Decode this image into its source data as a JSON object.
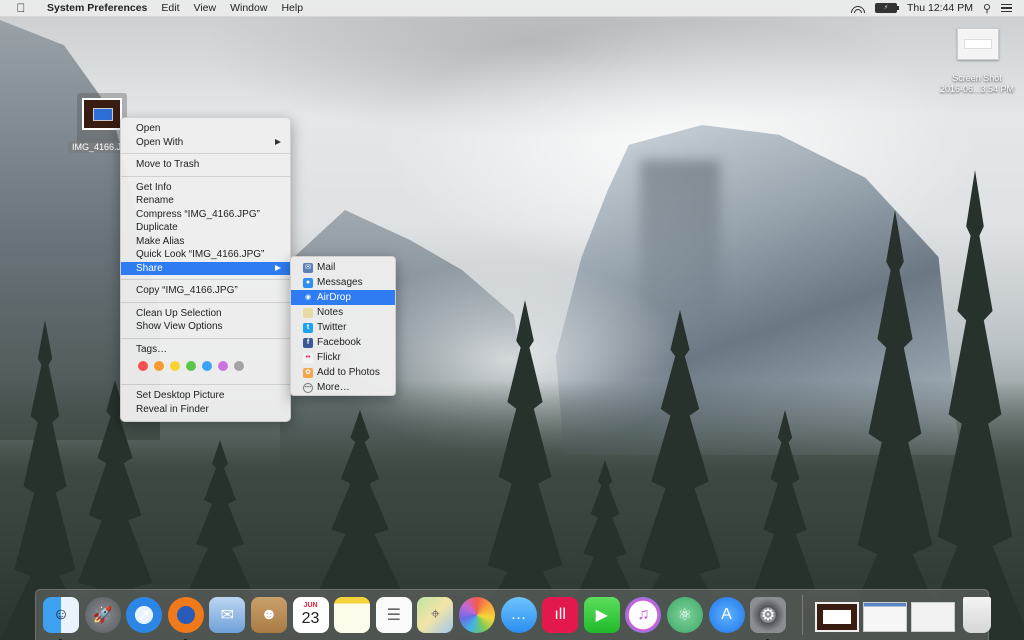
{
  "menubar": {
    "apple_icon": "apple-logo-icon",
    "app_name": "System Preferences",
    "menus": [
      "Edit",
      "View",
      "Window",
      "Help"
    ],
    "status": {
      "wifi_icon": "wifi-icon",
      "battery_icon": "battery-charging-icon",
      "battery_text": "⚡",
      "clock": "Thu 12:44 PM",
      "spotlight_icon": "spotlight-search-icon",
      "notification_icon": "notification-center-icon"
    }
  },
  "desktop": {
    "icons": [
      {
        "label": "IMG_4166.J...",
        "type": "image-file",
        "selected": true
      },
      {
        "label_line1": "Screen Shot",
        "label_line2": "2016-06...3.54 PM",
        "type": "screenshot-file"
      }
    ]
  },
  "context_menu": {
    "groups": [
      [
        {
          "label": "Open"
        },
        {
          "label": "Open With",
          "submenu": true
        }
      ],
      [
        {
          "label": "Move to Trash"
        }
      ],
      [
        {
          "label": "Get Info"
        },
        {
          "label": "Rename"
        },
        {
          "label": "Compress “IMG_4166.JPG”"
        },
        {
          "label": "Duplicate"
        },
        {
          "label": "Make Alias"
        },
        {
          "label": "Quick Look “IMG_4166.JPG”"
        },
        {
          "label": "Share",
          "submenu": true,
          "highlighted": true
        }
      ],
      [
        {
          "label": "Copy “IMG_4166.JPG”"
        }
      ],
      [
        {
          "label": "Clean Up Selection"
        },
        {
          "label": "Show View Options"
        }
      ],
      [
        {
          "label": "Tags…"
        }
      ],
      [
        {
          "label": "Set Desktop Picture"
        },
        {
          "label": "Reveal in Finder"
        }
      ]
    ],
    "tag_colors": [
      {
        "name": "red",
        "color": "#f8504f"
      },
      {
        "name": "orange",
        "color": "#f99a2e"
      },
      {
        "name": "yellow",
        "color": "#f6d332"
      },
      {
        "name": "green",
        "color": "#5ac74a"
      },
      {
        "name": "blue",
        "color": "#3ba3f7"
      },
      {
        "name": "purple",
        "color": "#cc73e1"
      },
      {
        "name": "gray",
        "color": "#a3a3a6"
      }
    ]
  },
  "share_menu": {
    "items": [
      {
        "label": "Mail",
        "icon": "mail-icon",
        "color": "#5b7fb6",
        "glyph": "✉"
      },
      {
        "label": "Messages",
        "icon": "messages-icon",
        "color": "#2f8ef0",
        "glyph": "●"
      },
      {
        "label": "AirDrop",
        "icon": "airdrop-icon",
        "color": "#2f7cf2",
        "glyph": "◉",
        "highlighted": true
      },
      {
        "label": "Notes",
        "icon": "notes-icon",
        "color": "#e9d9a2",
        "glyph": ""
      },
      {
        "label": "Twitter",
        "icon": "twitter-icon",
        "color": "#1da1f2",
        "glyph": "t"
      },
      {
        "label": "Facebook",
        "icon": "facebook-icon",
        "color": "#3b5998",
        "glyph": "f"
      },
      {
        "label": "Flickr",
        "icon": "flickr-icon",
        "color": "#f4f4f4",
        "glyph": "••"
      },
      {
        "label": "Add to Photos",
        "icon": "photos-icon",
        "color": "#f2a54a",
        "glyph": "✿"
      },
      {
        "label": "More…",
        "icon": "more-icon",
        "color": "#dddddd",
        "glyph": "⋯"
      }
    ]
  },
  "dock": {
    "apps": [
      {
        "name": "Finder",
        "icon": "finder-icon",
        "bg": "linear-gradient(90deg,#3da0f0 50%,#e8f3fb 50%)",
        "glyph": "☺",
        "running": true,
        "round": false
      },
      {
        "name": "Launchpad",
        "icon": "launchpad-icon",
        "bg": "radial-gradient(circle,#8a8d91,#55585c)",
        "glyph": "🚀",
        "running": false,
        "round": true
      },
      {
        "name": "Safari",
        "icon": "safari-icon",
        "bg": "radial-gradient(circle,#e9f3ff 35%,#2b86e6 36%)",
        "glyph": "➚",
        "running": false,
        "round": true
      },
      {
        "name": "Firefox",
        "icon": "firefox-icon",
        "bg": "radial-gradient(circle,#2a5bb8 35%,#f07a1a 36%)",
        "glyph": "",
        "running": true,
        "round": true
      },
      {
        "name": "Mail",
        "icon": "mail-stamp-icon",
        "bg": "linear-gradient(#bcd6f2,#6fa0d8)",
        "glyph": "✉",
        "running": false,
        "round": false
      },
      {
        "name": "Contacts",
        "icon": "contacts-icon",
        "bg": "linear-gradient(#c9a06a,#a97b44)",
        "glyph": "☻",
        "running": false,
        "round": false
      },
      {
        "name": "Calendar",
        "icon": "calendar-icon",
        "bg": "#ffffff",
        "glyph": "23",
        "month": "JUN",
        "running": false,
        "round": false
      },
      {
        "name": "Notes",
        "icon": "notes-app-icon",
        "bg": "linear-gradient(#f6d23a 18%,#fdfbe9 18%)",
        "glyph": "",
        "running": false,
        "round": false
      },
      {
        "name": "Reminders",
        "icon": "reminders-icon",
        "bg": "#fafafa",
        "glyph": "☰",
        "running": false,
        "round": false
      },
      {
        "name": "Maps",
        "icon": "maps-icon",
        "bg": "linear-gradient(135deg,#bfe3a6,#f3e4a6,#9cc8ef)",
        "glyph": "⌖",
        "running": false,
        "round": false
      },
      {
        "name": "Photos",
        "icon": "photos-app-icon",
        "bg": "conic-gradient(#f25b4c,#f6a33a,#f6d83a,#77c95a,#3fb4e8,#6b6ce3,#c467d8,#f25b4c)",
        "glyph": "",
        "running": false,
        "round": true
      },
      {
        "name": "Messages",
        "icon": "messages-app-icon",
        "bg": "linear-gradient(#6fc4ff,#2a8ef0)",
        "glyph": "…",
        "running": false,
        "round": true
      },
      {
        "name": "Scrivener",
        "icon": "red-app-icon",
        "bg": "#e3194d",
        "glyph": "ıll",
        "running": false,
        "round": false
      },
      {
        "name": "FaceTime",
        "icon": "facetime-icon",
        "bg": "linear-gradient(#5bde5b,#21b92a)",
        "glyph": "▶",
        "running": false,
        "round": false
      },
      {
        "name": "iTunes",
        "icon": "itunes-icon",
        "bg": "radial-gradient(circle,#fff 55%,#d95ad4 57%,#5b8ef2 80%)",
        "glyph": "♫",
        "running": false,
        "round": true
      },
      {
        "name": "Atom",
        "icon": "atom-icon",
        "bg": "radial-gradient(circle,#7fd39a,#3ba767)",
        "glyph": "⚛",
        "running": false,
        "round": true
      },
      {
        "name": "App Store",
        "icon": "app-store-icon",
        "bg": "radial-gradient(circle,#5cb3ff,#1f73e8)",
        "glyph": "A",
        "running": false,
        "round": true
      },
      {
        "name": "System Preferences",
        "icon": "system-preferences-icon",
        "bg": "radial-gradient(circle,#8e9196 30%,#4e5156 31%,#8a8d92 65%)",
        "glyph": "⚙",
        "running": true,
        "round": false
      }
    ],
    "minimized_windows": [
      {
        "name": "IMG_4166 preview window",
        "icon": "image-window-thumbnail"
      },
      {
        "name": "Firefox window",
        "icon": "firefox-window-thumbnail"
      },
      {
        "name": "System Preferences window",
        "icon": "system-preferences-window-thumbnail"
      }
    ],
    "trash": {
      "name": "Trash",
      "icon": "trash-icon"
    }
  }
}
